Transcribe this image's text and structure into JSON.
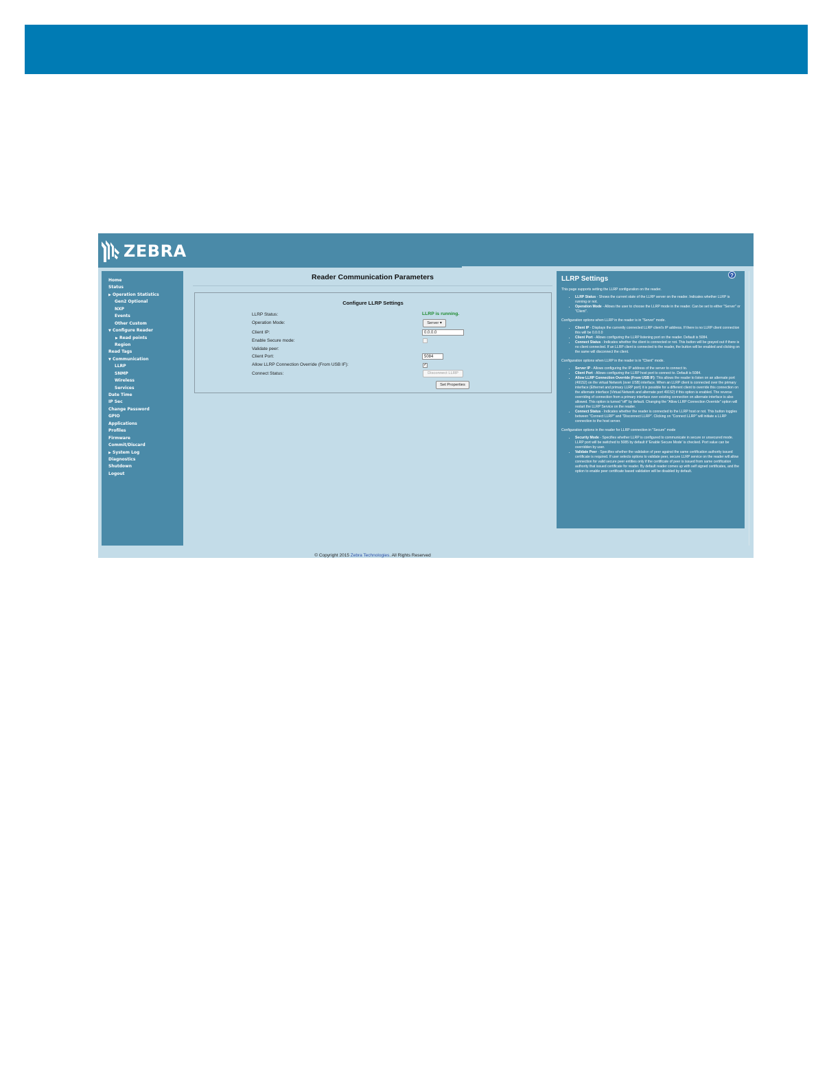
{
  "app": {
    "brand": "ZEBRA"
  },
  "sidebar": {
    "items": [
      {
        "label": "Home",
        "level": 1,
        "expander": ""
      },
      {
        "label": "Status",
        "level": 1,
        "expander": ""
      },
      {
        "label": "Operation Statistics",
        "level": 1,
        "expander": "right"
      },
      {
        "label": "Gen2 Optional",
        "level": 2,
        "expander": ""
      },
      {
        "label": "NXP",
        "level": 2,
        "expander": ""
      },
      {
        "label": "Events",
        "level": 2,
        "expander": ""
      },
      {
        "label": "Other Custom",
        "level": 2,
        "expander": ""
      },
      {
        "label": "Configure Reader",
        "level": 1,
        "expander": "down"
      },
      {
        "label": "Read points",
        "level": 3,
        "expander": "right"
      },
      {
        "label": "Region",
        "level": 2,
        "expander": ""
      },
      {
        "label": "Read Tags",
        "level": 1,
        "expander": ""
      },
      {
        "label": "Communication",
        "level": 1,
        "expander": "down"
      },
      {
        "label": "LLRP",
        "level": 2,
        "expander": ""
      },
      {
        "label": "SNMP",
        "level": 2,
        "expander": ""
      },
      {
        "label": "Wireless",
        "level": 2,
        "expander": ""
      },
      {
        "label": "Services",
        "level": 2,
        "expander": ""
      },
      {
        "label": "Date Time",
        "level": 1,
        "expander": ""
      },
      {
        "label": "IP Sec",
        "level": 1,
        "expander": ""
      },
      {
        "label": "Change Password",
        "level": 1,
        "expander": ""
      },
      {
        "label": "GPIO",
        "level": 1,
        "expander": ""
      },
      {
        "label": "Applications",
        "level": 1,
        "expander": ""
      },
      {
        "label": "Profiles",
        "level": 1,
        "expander": ""
      },
      {
        "label": "Firmware",
        "level": 1,
        "expander": ""
      },
      {
        "label": "Commit/Discard",
        "level": 1,
        "expander": ""
      },
      {
        "label": "System Log",
        "level": 1,
        "expander": "right"
      },
      {
        "label": "Diagnostics",
        "level": 1,
        "expander": ""
      },
      {
        "label": "Shutdown",
        "level": 1,
        "expander": ""
      },
      {
        "label": "Logout",
        "level": 1,
        "expander": ""
      }
    ]
  },
  "main": {
    "title": "Reader Communication Parameters",
    "config": {
      "title": "Configure LLRP Settings",
      "labels": {
        "llrp_status": "LLRP Status:",
        "operation_mode": "Operation Mode:",
        "client_ip": "Client IP:",
        "enable_secure": "Enable Secure mode:",
        "validate_peer": "Validate peer:",
        "client_port": "Client Port:",
        "allow_override": "Allow LLRP Connection Override (From USB IF):",
        "connect_status": "Connect Status:"
      },
      "llrp_status_value": "LLRP is running.",
      "operation_mode_value": "Server",
      "client_ip_value": "0.0.0.0",
      "client_port_value": "5084",
      "enable_secure_checked": false,
      "allow_override_checked": true,
      "disconnect_button": "Disconnect LLRP",
      "set_properties_button": "Set Properties"
    }
  },
  "help": {
    "title": "LLRP Settings",
    "help_icon": "?",
    "intro": "This page supports setting the LLRP configuration on the reader.",
    "general": [
      {
        "term": "LLRP Status",
        "desc": " - Shows the current state of the LLRP server on the reader. Indicates whether LLRP is running or not."
      },
      {
        "term": "Operation Mode",
        "desc": " - Allows the user to choose the LLRP mode in the reader. Can be set to either \"Server\" or \"Client\"."
      }
    ],
    "server_heading": "Configuration options when LLRP in the reader is in \"Server\" mode.",
    "server": [
      {
        "term": "Client IP",
        "desc": " - Displays the currently connected LLRP client's IP address. If there is no LLRP client connection this will be 0.0.0.0"
      },
      {
        "term": "Client Port",
        "desc": " - Allows configuring the LLRP listening port on the reader. Default is 5084."
      },
      {
        "term": "Connect Status",
        "desc": " - Indicates whether the client is connected or not. This button will be grayed out if there is no client connected. If an LLRP client is connected to the reader, the button will be enabled and clicking on the same will disconnect the client."
      }
    ],
    "client_heading": "Configuration options when LLRP in the reader is in \"Client\" mode.",
    "client": [
      {
        "term": "Server IP",
        "desc": " - Allows configuring the IP address of the server to connect to."
      },
      {
        "term": "Client Port",
        "desc": " - Allows configuring the LLRP host port to connect to. Default is 5084."
      },
      {
        "term": "Allow LLRP Connection Override (From USB IF)",
        "desc": ": This allows the reader to listen on an alternate port (49152) on the virtual Network (over USB) interface. When an LLRP client is connected over the primary interface (Ethernet and primary LLRP port) it is possible for a different client to override this connection on the alternate interface (Virtual Network and alternate port 49152) if this option is enabled. The reverse overriding of connection from a primary interface over existing connection on alternate interface is also allowed. This option is turned \"off\" by default. Changing the \"Allow LLRP Connection Override\" option will restart the LLRP Service on the reader."
      },
      {
        "term": "Connect Status",
        "desc": " - Indicates whether the reader is connected to the LLRP host or not. This button toggles between \"Connect LLRP\" and \"Disconnect LLRP\". Clicking on \"Connect LLRP\" will initiate a LLRP connection to the host server."
      }
    ],
    "secure_heading": "Configuration options in the reader for LLRP connection in \"Secure\" mode",
    "secure": [
      {
        "term": "Security Mode",
        "desc": " - Specifies whether LLRP is configured to communicate in secure or unsecured mode. LLRP port will be switched to 5085 by default if 'Enable Secure Mode' is checked. Port value can be overridden by user."
      },
      {
        "term": "Validate Peer",
        "desc": " - Specifies whether the validation of peer against the same certification authority issued certificate is required. If user selects options to validate peer, secure LLRP service on the reader will allow connection for valid secure peer entities only if the certificate of peer is issued from same certification authority that issued certificate for reader. By default reader comes up with self signed certificates, and the option to enable peer certificate based validation will be disabled by default."
      }
    ]
  },
  "footer": {
    "prefix": "© Copyright 2015 ",
    "link": "Zebra Technologies",
    "suffix": ". All Rights Reserved"
  },
  "colors": {
    "doc_banner": "#007bb4",
    "app_chrome": "#4a8aa8",
    "page_background": "#c3dce8",
    "status_ok": "#1e8a2e"
  }
}
